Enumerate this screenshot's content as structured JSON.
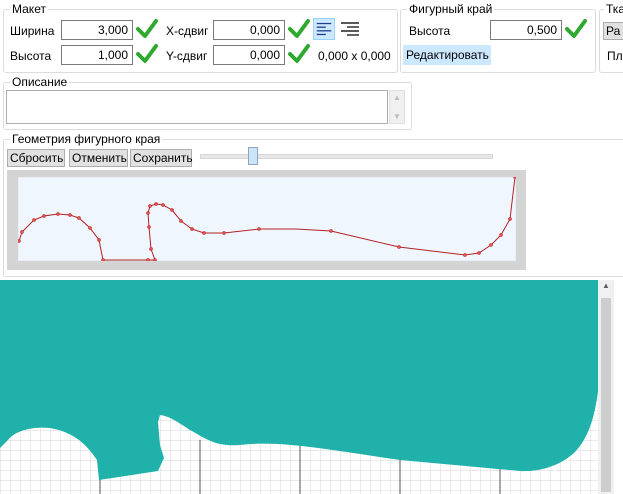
{
  "layout_group": {
    "title": "Макет",
    "width_label": "Ширина",
    "width_value": "3,000",
    "height_label": "Высота",
    "height_value": "1,000",
    "xshift_label": "X-сдвиг",
    "xshift_value": "0,000",
    "yshift_label": "Y-сдвиг",
    "yshift_value": "0,000",
    "size_readout": "0,000 x 0,000"
  },
  "shaped_edge_group": {
    "title": "Фигурный край",
    "height_label": "Высота",
    "height_value": "0,500",
    "edit_label": "Редактировать"
  },
  "fabric_group": {
    "title": "Тка",
    "btn_label": "Ра",
    "label2": "Пл"
  },
  "description_group": {
    "title": "Описание",
    "value": ""
  },
  "geometry_group": {
    "title": "Геометрия фигурного края",
    "reset_label": "Сбросить",
    "undo_label": "Отменить",
    "save_label": "Сохранить",
    "slider_value": 0.17
  },
  "colors": {
    "accent": "#cce8ff",
    "check_green": "#2ea82e",
    "curve": "#b22222",
    "teal": "#20b2aa",
    "grid": "#d6d6d6"
  }
}
